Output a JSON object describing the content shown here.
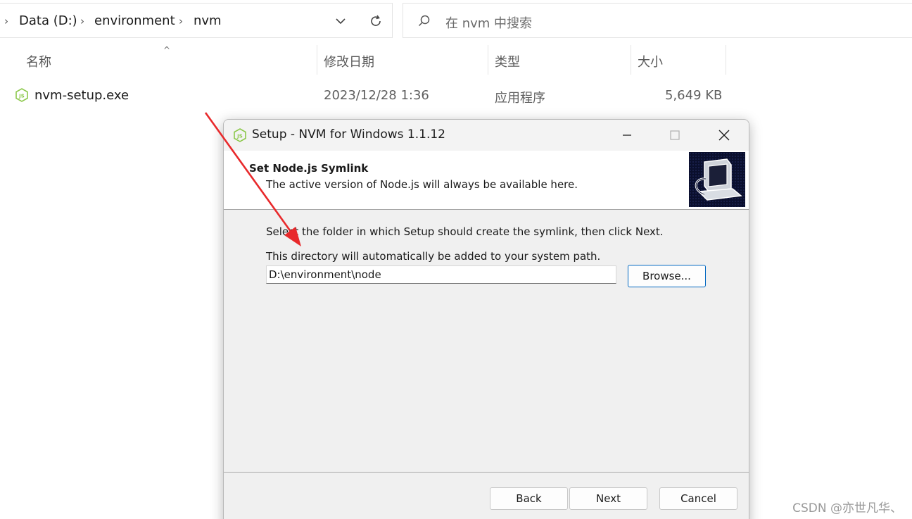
{
  "explorer": {
    "breadcrumb": [
      "Data (D:)",
      "environment",
      "nvm"
    ],
    "search_placeholder": "在 nvm 中搜索",
    "columns": {
      "name": "名称",
      "modified": "修改日期",
      "type": "类型",
      "size": "大小"
    },
    "files": [
      {
        "name": "nvm-setup.exe",
        "modified": "2023/12/28 1:36",
        "type": "应用程序",
        "size": "5,649 KB",
        "icon": "nodejs-icon"
      }
    ]
  },
  "dialog": {
    "title": "Setup - NVM for Windows 1.1.12",
    "header_title": "Set Node.js Symlink",
    "header_subtitle": "The active version of Node.js will always be available here.",
    "instruction": "Select the folder in which Setup should create the symlink, then click Next.",
    "path_note": "This directory will automatically be added to your system path.",
    "path_value": "D:\\environment\\node",
    "browse_label": "Browse...",
    "back_label": "Back",
    "next_label": "Next",
    "cancel_label": "Cancel"
  },
  "watermark": "CSDN @亦世凡华、",
  "colors": {
    "arrow": "#e8292b",
    "accent": "#0067c0",
    "nodejs_green": "#8cc84b"
  }
}
